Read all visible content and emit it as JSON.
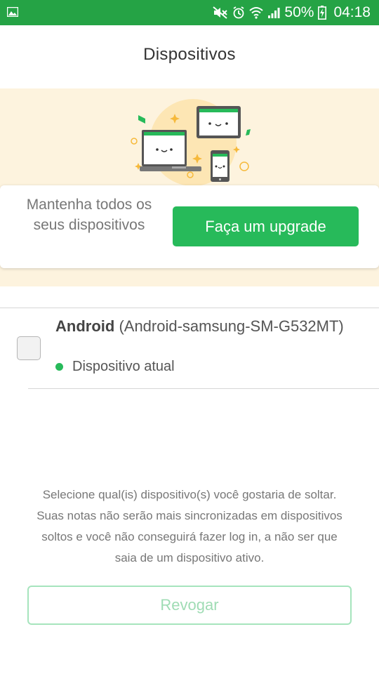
{
  "status_bar": {
    "battery": "50%",
    "time": "04:18",
    "icons": [
      "gallery-icon",
      "mute-icon",
      "alarm-icon",
      "wifi-icon",
      "signal-icon",
      "battery-icon"
    ]
  },
  "header": {
    "title": "Dispositivos"
  },
  "upgrade": {
    "text": "Mantenha todos os seus dispositivos",
    "button_label": "Faça um upgrade"
  },
  "devices": [
    {
      "name_bold": "Android",
      "name_rest": " (Android-samsung-SM-G532MT)",
      "status": "Dispositivo atual",
      "checked": false
    }
  ],
  "info": {
    "text": "Selecione qual(is) dispositivo(s) você gostaria de soltar. Suas notas não serão mais sincronizadas em dispositivos soltos e você não conseguirá fazer log in, a não ser que saia de um dispositivo ativo."
  },
  "revoke": {
    "label": "Revogar"
  },
  "colors": {
    "status_bar": "#25a345",
    "accent_green": "#27ba5a",
    "promo_bg": "#fdf3de",
    "revoke_border": "#a6e4bd"
  }
}
